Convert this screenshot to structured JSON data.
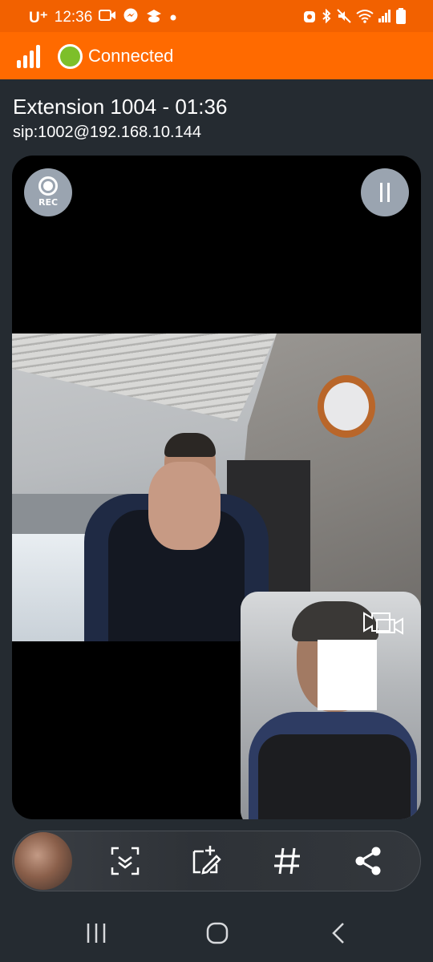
{
  "status_bar": {
    "carrier": "U⁺",
    "time": "12:36",
    "left_icons": [
      "video-call-icon",
      "messenger-icon",
      "app-icon",
      "notification-dot-icon"
    ],
    "right_icons": [
      "app-badge-icon",
      "bluetooth-icon",
      "mute-icon",
      "wifi-icon",
      "signal-icon",
      "battery-icon"
    ]
  },
  "app_bar": {
    "status_text": "Connected",
    "status_color": "#7dbf2a",
    "bar_color": "#ff6a00"
  },
  "call": {
    "title": "Extension 1004 - 01:36",
    "sip_uri": "sip:1002@192.168.10.144"
  },
  "video_controls": {
    "record_label": "REC"
  },
  "toolbar": {
    "buttons": [
      "scan-icon",
      "add-edit-icon",
      "dialpad-hash-icon",
      "share-icon"
    ]
  },
  "nav_bar": {
    "buttons": [
      "recents-icon",
      "home-icon",
      "back-icon"
    ]
  }
}
